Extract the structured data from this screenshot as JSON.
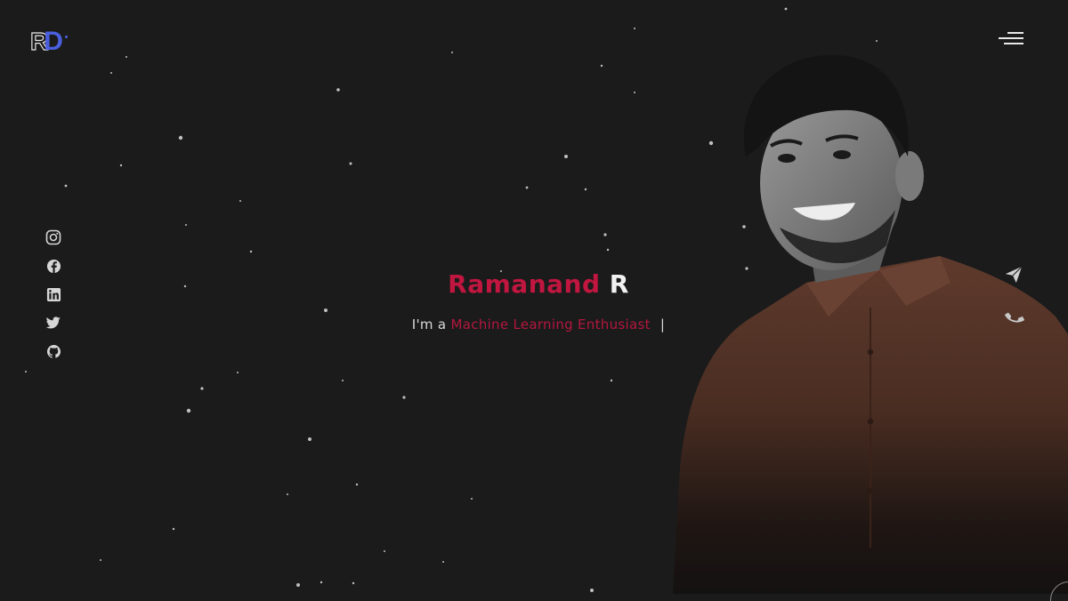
{
  "logo": {
    "letter_r": "R",
    "letter_d": "D"
  },
  "hero": {
    "first_name": "Ramanand",
    "last_initial": "R",
    "tagline_prefix": "I'm a",
    "tagline_role": "Machine Learning Enthusiast",
    "typing_cursor": "|"
  },
  "social": [
    "instagram-icon",
    "facebook-icon",
    "linkedin-icon",
    "twitter-icon",
    "github-icon"
  ],
  "icons": {
    "menu": "hamburger-menu-icon",
    "send": "send-icon",
    "phone": "phone-icon"
  },
  "colors": {
    "background": "#1b1b1c",
    "accent_red": "#c0163f",
    "logo_blue": "#4a5fe0",
    "text_light": "#e8e8e8"
  }
}
